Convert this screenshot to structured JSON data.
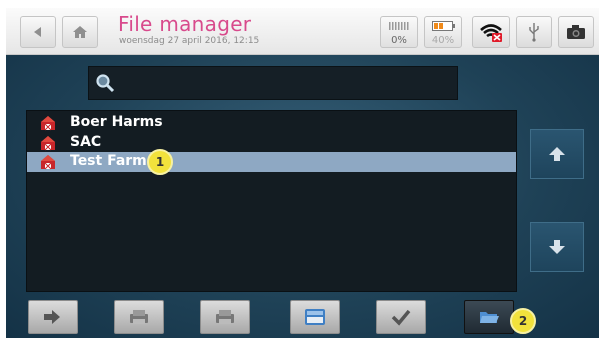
{
  "header": {
    "title": "File manager",
    "subtitle": "woensdag 27 april 2016, 12:15",
    "back_icon": "back-icon",
    "home_icon": "home-icon",
    "status": [
      {
        "name": "memory",
        "value": "0%"
      },
      {
        "name": "battery",
        "value": "40%"
      }
    ],
    "icons": [
      "wifi-disconnected-icon",
      "usb-icon",
      "camera-icon"
    ]
  },
  "search": {
    "placeholder": "",
    "value": ""
  },
  "files": [
    {
      "label": "Boer Harms",
      "selected": false
    },
    {
      "label": "SAC",
      "selected": false
    },
    {
      "label": "Test Farm",
      "selected": true
    }
  ],
  "markers": {
    "one": "1",
    "two": "2"
  },
  "colors": {
    "title": "#d84a8c",
    "selection": "#8ea8c3",
    "badge": "#f2e23c",
    "background": "#1f4257"
  },
  "toolbar": [
    "exit-icon",
    "print-icon",
    "print-alt-icon",
    "keyboard-icon",
    "check-icon",
    "open-folder-icon"
  ]
}
